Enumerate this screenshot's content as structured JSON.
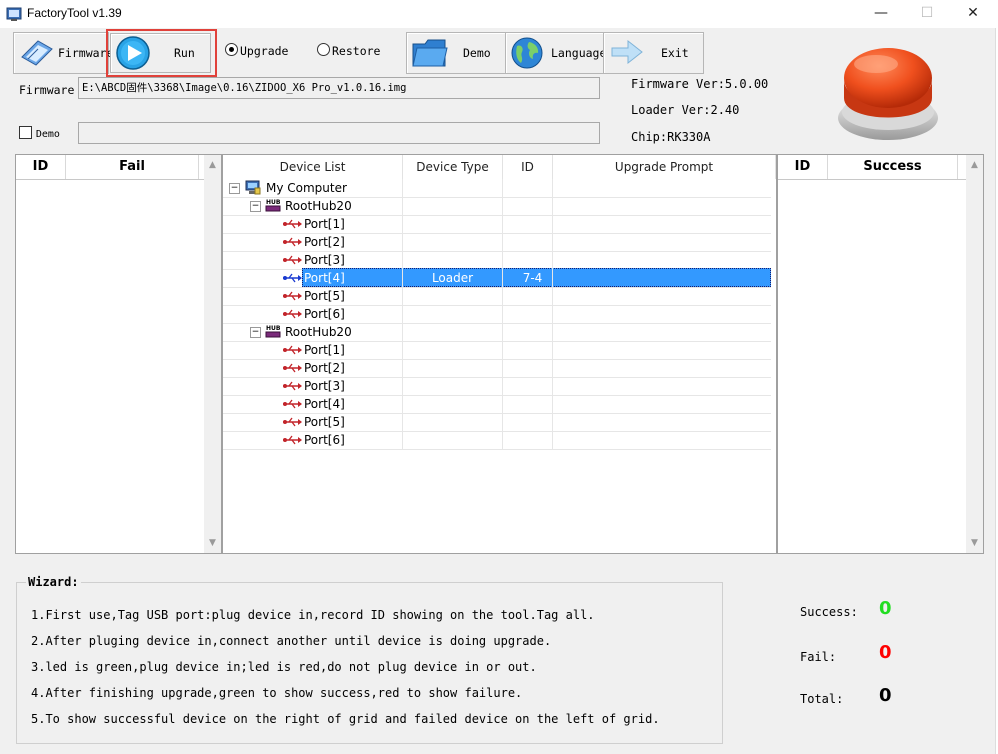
{
  "window": {
    "title": "FactoryTool v1.39",
    "minimize": "—",
    "maximize": "☐",
    "close": "✕"
  },
  "toolbar": {
    "firmware": "Firmware",
    "run": "Run",
    "upgrade": "Upgrade",
    "restore": "Restore",
    "demo": "Demo",
    "language": "Language",
    "exit": "Exit"
  },
  "firmware_field": {
    "label": "Firmware",
    "value": "E:\\ABCD固件\\3368\\Image\\0.16\\ZIDOO_X6 Pro_v1.0.16.img"
  },
  "demo_field": {
    "label": "Demo",
    "value": ""
  },
  "info": {
    "firmware_ver": "Firmware Ver:5.0.00",
    "loader_ver": "Loader Ver:2.40",
    "chip": "Chip:RK330A"
  },
  "fail_grid": {
    "columns": [
      "ID",
      "Fail"
    ]
  },
  "success_grid": {
    "columns": [
      "ID",
      "Success"
    ]
  },
  "device_grid": {
    "columns": [
      "Device List",
      "Device Type",
      "ID",
      "Upgrade Prompt"
    ],
    "root": "My Computer",
    "hubs": [
      {
        "name": "RootHub20",
        "ports": [
          {
            "name": "Port[1]",
            "type": "",
            "id": "",
            "prompt": ""
          },
          {
            "name": "Port[2]",
            "type": "",
            "id": "",
            "prompt": ""
          },
          {
            "name": "Port[3]",
            "type": "",
            "id": "",
            "prompt": ""
          },
          {
            "name": "Port[4]",
            "type": "Loader",
            "id": "7-4",
            "prompt": ""
          },
          {
            "name": "Port[5]",
            "type": "",
            "id": "",
            "prompt": ""
          },
          {
            "name": "Port[6]",
            "type": "",
            "id": "",
            "prompt": ""
          }
        ]
      },
      {
        "name": "RootHub20",
        "ports": [
          {
            "name": "Port[1]",
            "type": "",
            "id": "",
            "prompt": ""
          },
          {
            "name": "Port[2]",
            "type": "",
            "id": "",
            "prompt": ""
          },
          {
            "name": "Port[3]",
            "type": "",
            "id": "",
            "prompt": ""
          },
          {
            "name": "Port[4]",
            "type": "",
            "id": "",
            "prompt": ""
          },
          {
            "name": "Port[5]",
            "type": "",
            "id": "",
            "prompt": ""
          },
          {
            "name": "Port[6]",
            "type": "",
            "id": "",
            "prompt": ""
          }
        ]
      }
    ],
    "selected": "hub0-port4"
  },
  "wizard": {
    "title": "Wizard:",
    "lines": [
      "1.First use,Tag USB port:plug device in,record ID showing on the tool.Tag all.",
      "2.After pluging device in,connect another until device is doing upgrade.",
      "3.led is green,plug device in;led is red,do not plug device in or out.",
      "4.After finishing upgrade,green to show success,red to show failure.",
      "5.To show successful device on the right of grid and failed device on the left of grid."
    ]
  },
  "stats": {
    "success_label": "Success:",
    "success_value": "0",
    "fail_label": "Fail:",
    "fail_value": "0",
    "total_label": "Total:",
    "total_value": "0"
  },
  "colors": {
    "success": "#22dd22",
    "fail": "#ff0000",
    "selection": "#3399ff",
    "run_highlight": "#e0413a"
  }
}
